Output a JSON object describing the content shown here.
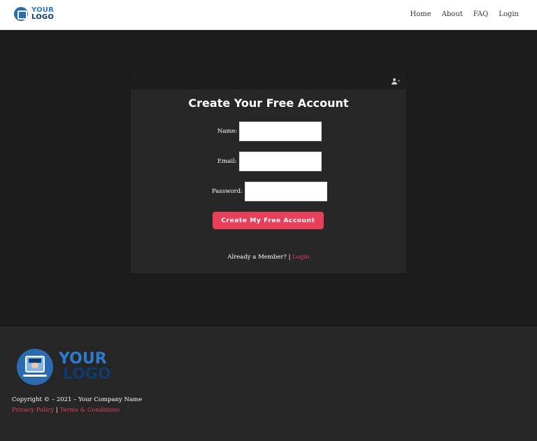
{
  "header": {
    "logo_line1": "YOUR",
    "logo_line2": "LOGO",
    "nav": [
      "Home",
      "About",
      "FAQ",
      "Login"
    ]
  },
  "form": {
    "title": "Create Your Free Account",
    "name_label": "Name:",
    "email_label": "Email:",
    "password_label": "Password:",
    "name_value": "",
    "email_value": "",
    "password_value": "",
    "submit_label": "Create My Free Account",
    "member_text": "Already a Member?",
    "member_sep": "|",
    "login_link": "Login"
  },
  "footer": {
    "logo_line1": "YOUR",
    "logo_line2": "LOGO",
    "copyright": "Copyright © – 2021 – Your Company Name",
    "privacy": "Privacy Policy",
    "sep": "|",
    "terms": "Terms & Conditions"
  },
  "colors": {
    "accent": "#e8405a",
    "brand_blue": "#2a7bd1",
    "brand_dark": "#0e3b6e"
  }
}
